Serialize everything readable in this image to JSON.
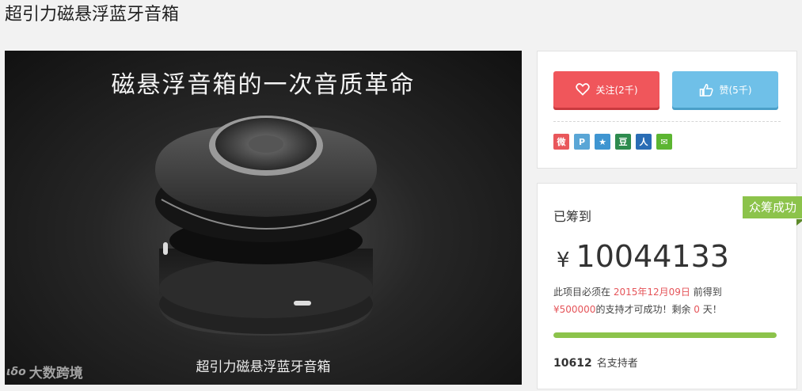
{
  "page": {
    "title": "超引力磁悬浮蓝牙音箱"
  },
  "hero": {
    "headline": "磁悬浮音箱的一次音质革命",
    "caption": "超引力磁悬浮蓝牙音箱",
    "watermark": "大数跨境",
    "watermark_logo": "ιδο"
  },
  "actions": {
    "follow_label": "关注(2千)",
    "like_label": "赞(5千)"
  },
  "share": [
    {
      "icon": "weibo-icon",
      "glyph": "微",
      "color": "#e9575b"
    },
    {
      "icon": "pinterest-icon",
      "glyph": "P",
      "color": "#5aa6d6"
    },
    {
      "icon": "qzone-star-icon",
      "glyph": "★",
      "color": "#3f95d1"
    },
    {
      "icon": "douban-icon",
      "glyph": "豆",
      "color": "#2e8b4e"
    },
    {
      "icon": "renren-icon",
      "glyph": "人",
      "color": "#2a6db5"
    },
    {
      "icon": "wechat-icon",
      "glyph": "✉",
      "color": "#5cb531"
    }
  ],
  "funding": {
    "raised_label": "已筹到",
    "status_badge": "众筹成功",
    "currency": "¥",
    "amount": "10044133",
    "deadline_prefix": "此项目必须在",
    "deadline_date": "2015年12月09日",
    "deadline_suffix": "前得到",
    "goal_amount": "¥500000",
    "goal_suffix": "的支持才可成功！剩余",
    "days_left": "0",
    "days_unit": "天！",
    "progress_fraction": 1.0,
    "backers_count": "10612",
    "backers_label": "名支持者"
  },
  "colors": {
    "accent_red": "#f0565b",
    "accent_blue": "#6fc0e8",
    "success_green": "#8cc34b"
  }
}
